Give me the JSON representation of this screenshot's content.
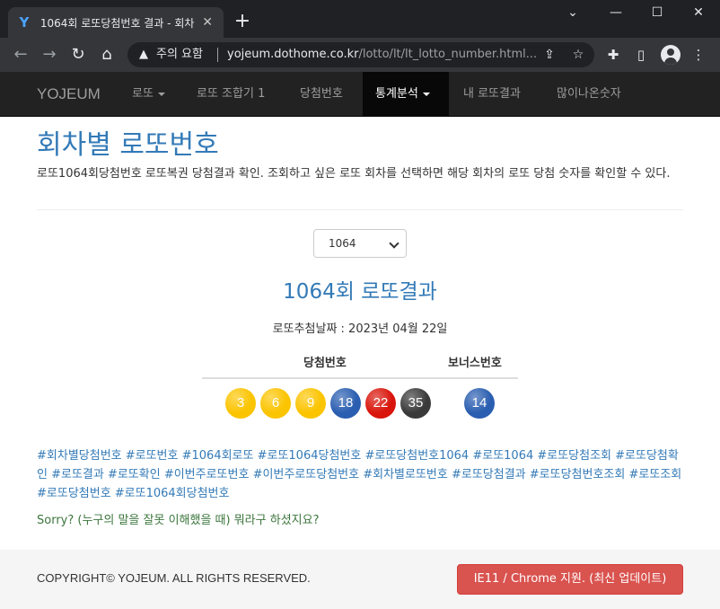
{
  "browser": {
    "tab_title": "1064회 로또당첨번호 결과 - 회차",
    "favicon": "Y",
    "new_tab": "+",
    "omnibox": {
      "warning": "주의 요함",
      "url_host": "yojeum.dothome.co.kr",
      "url_path": "/lotto/lt/lt_lotto_number.html..."
    }
  },
  "navbar": {
    "brand": "YOJEUM",
    "items": [
      {
        "label": "로또",
        "dropdown": true
      },
      {
        "label": "로또 조합기 1"
      },
      {
        "label": "당첨번호"
      },
      {
        "label": "통계분석",
        "dropdown": true,
        "active": true
      },
      {
        "label": "내 로또결과"
      },
      {
        "label": "많이나온숫자"
      }
    ]
  },
  "main": {
    "title": "회차별 로또번호",
    "description": "로또1064회당첨번호 로또복권 당첨결과 확인. 조회하고 싶은 로또 회차를 선택하면 해당 회차의 로또 당첨 숫자를 확인할 수 있다.",
    "select_value": "1064",
    "result_title": "1064회 로또결과",
    "draw_date": "로또추첨날짜 : 2023년 04월 22일",
    "headers": {
      "winning": "당첨번호",
      "bonus": "보너스번호"
    },
    "winning_numbers": [
      {
        "number": "3",
        "color": "#fbc400"
      },
      {
        "number": "6",
        "color": "#fbc400"
      },
      {
        "number": "9",
        "color": "#fbc400"
      },
      {
        "number": "18",
        "color": "#2a5eb0"
      },
      {
        "number": "22",
        "color": "#d9150b"
      },
      {
        "number": "35",
        "color": "#3a3a3a"
      }
    ],
    "bonus_number": {
      "number": "14",
      "color": "#2a5eb0"
    },
    "tags": "#회차별당첨번호 #로또번호 #1064회로또 #로또1064당첨번호 #로또당첨번호1064 #로또1064 #로또당첨조회 #로또당첨확인 #로또결과 #로또확인 #이번주로또번호 #이번주로또당첨번호 #회차별로또번호 #로또당첨결과 #로또당첨번호조회 #로또조회 #로또당첨번호 #로또1064회당첨번호",
    "sorry": "Sorry? (누구의 말을 잘못 이해했을 때) 뭐라구 하셨지요?"
  },
  "footer": {
    "copyright": "COPYRIGHT© YOJEUM. ALL RIGHTS RESERVED.",
    "button": "IE11 / Chrome 지원. (최신 업데이트)"
  }
}
